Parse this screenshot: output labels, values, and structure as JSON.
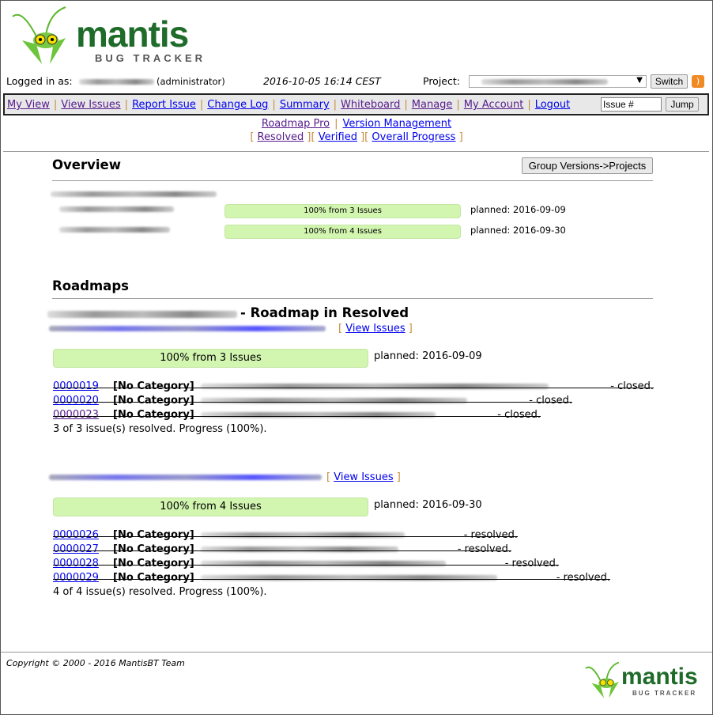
{
  "logo": {
    "word": "mantis",
    "tagline": "BUG TRACKER"
  },
  "header": {
    "logged_in_label": "Logged in as:",
    "role": "(administrator)",
    "datetime": "2016-10-05 16:14 CEST",
    "project_label": "Project:",
    "switch_label": "Switch",
    "rss_icon": "rss-icon"
  },
  "menu": {
    "items": [
      {
        "label": "My View",
        "visited": true
      },
      {
        "label": "View Issues",
        "visited": true
      },
      {
        "label": "Report Issue",
        "visited": false
      },
      {
        "label": "Change Log",
        "visited": false
      },
      {
        "label": "Summary",
        "visited": false
      },
      {
        "label": "Whiteboard",
        "visited": true
      },
      {
        "label": "Manage",
        "visited": true
      },
      {
        "label": "My Account",
        "visited": true
      },
      {
        "label": "Logout",
        "visited": false
      }
    ],
    "issue_placeholder": "Issue #",
    "jump_label": "Jump"
  },
  "submenu": {
    "roadmap_pro": "Roadmap Pro",
    "version_management": "Version Management",
    "resolved": "Resolved",
    "verified": "Verified",
    "overall_progress": "Overall Progress"
  },
  "overview": {
    "title": "Overview",
    "group_button": "Group Versions->Projects",
    "versions": [
      {
        "progress_pct": 100,
        "bar_text": "100% from 3 Issues",
        "planned": "planned: 2016-09-09"
      },
      {
        "progress_pct": 100,
        "bar_text": "100% from 4 Issues",
        "planned": "planned: 2016-09-30"
      }
    ]
  },
  "roadmaps": {
    "title": "Roadmaps",
    "project_suffix": "- Roadmap in Resolved",
    "view_issues": "View Issues",
    "versions": [
      {
        "progress_pct": 100,
        "bar_text": "100% from 3 Issues",
        "planned": "planned: 2016-09-09",
        "issues": [
          {
            "id": "0000019",
            "category": "[No Category]",
            "status": "- closed."
          },
          {
            "id": "0000020",
            "category": "[No Category]",
            "status": "- closed."
          },
          {
            "id": "0000023",
            "category": "[No Category]",
            "status": "- closed."
          }
        ],
        "summary": "3 of 3 issue(s) resolved. Progress (100%)."
      },
      {
        "progress_pct": 100,
        "bar_text": "100% from 4 Issues",
        "planned": "planned: 2016-09-30",
        "issues": [
          {
            "id": "0000026",
            "category": "[No Category]",
            "status": "- resolved."
          },
          {
            "id": "0000027",
            "category": "[No Category]",
            "status": "- resolved."
          },
          {
            "id": "0000028",
            "category": "[No Category]",
            "status": "- resolved."
          },
          {
            "id": "0000029",
            "category": "[No Category]",
            "status": "- resolved."
          }
        ],
        "summary": "4 of 4 issue(s) resolved. Progress (100%)."
      }
    ]
  },
  "footer": {
    "copyright": "Copyright © 2000 - 2016 MantisBT Team"
  }
}
